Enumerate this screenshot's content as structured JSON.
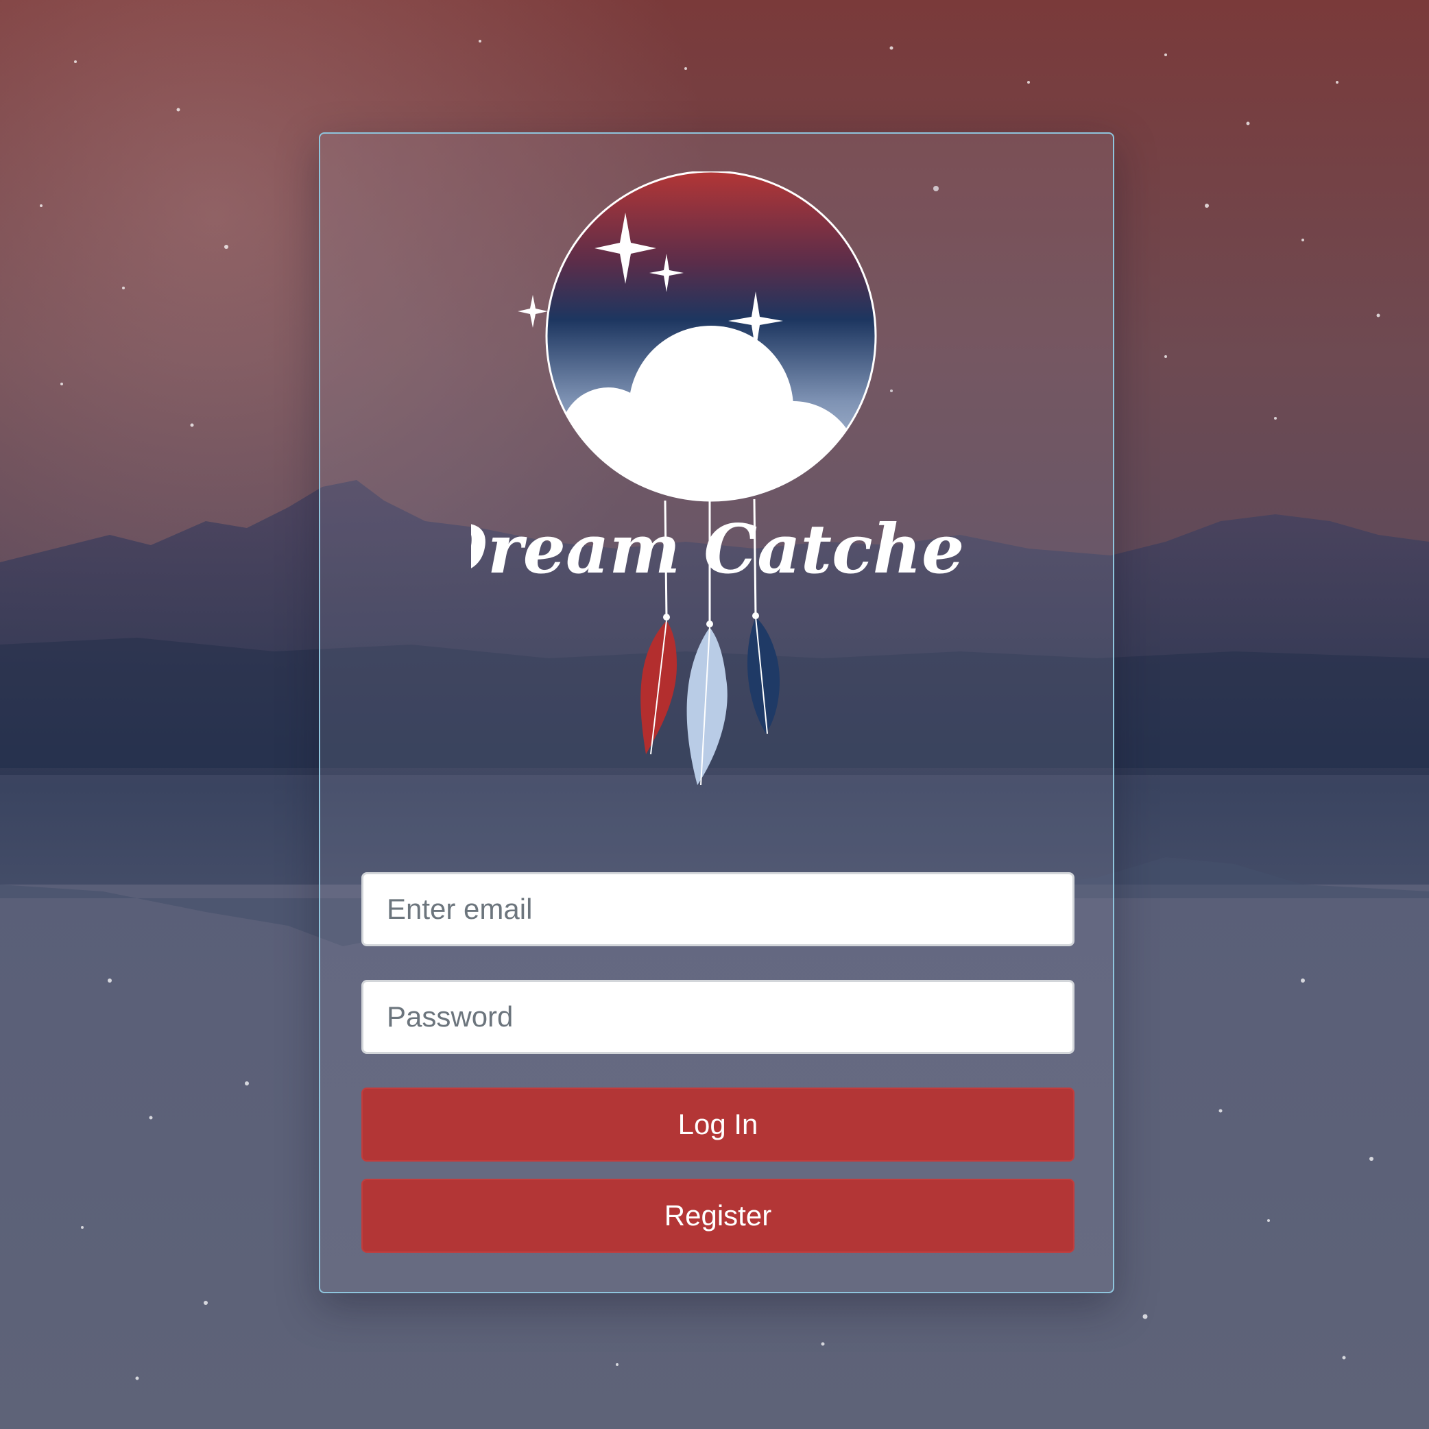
{
  "brand": {
    "name": "Dream Catcher"
  },
  "login_form": {
    "email_placeholder": "Enter email",
    "email_value": "",
    "password_placeholder": "Password",
    "password_value": "",
    "login_label": "Log In",
    "register_label": "Register"
  },
  "colors": {
    "accent": "#b33636",
    "card_border": "#8fc5dd",
    "feather_red": "#b32e2e",
    "feather_light": "#b9cce6",
    "feather_navy": "#1f3a66"
  },
  "icons": [
    "dreamcatcher-logo",
    "star-icon",
    "cloud-icon",
    "feather-icon"
  ]
}
